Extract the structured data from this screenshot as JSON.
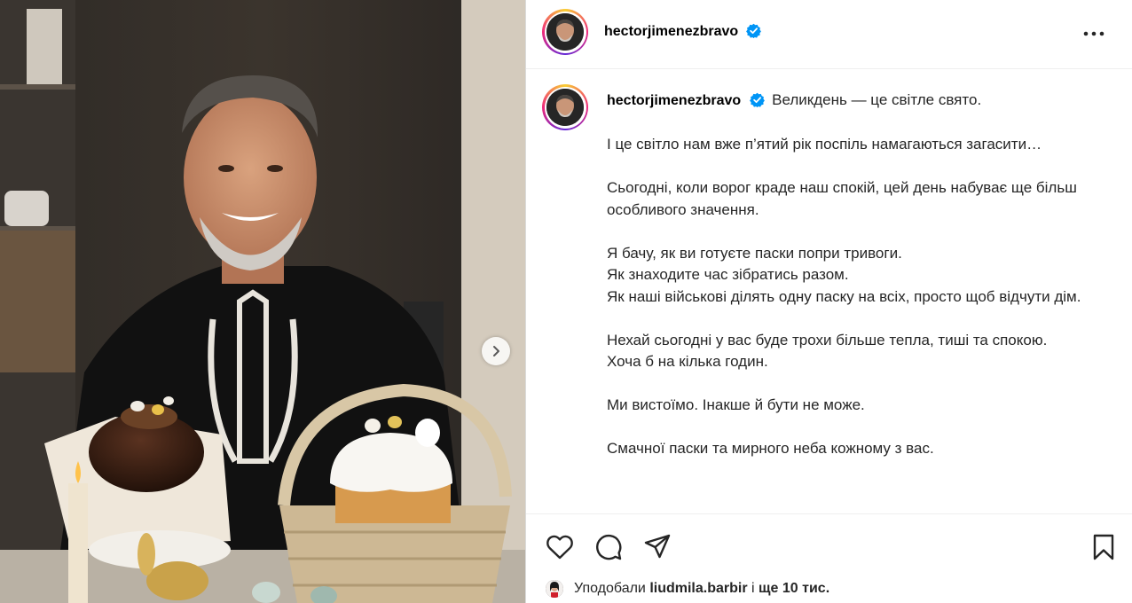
{
  "post": {
    "username": "hectorjimenezbravo",
    "verified": true
  },
  "caption": {
    "first_line": "Великдень — це світле свято.",
    "paragraphs": [
      "І це світло нам вже п’ятий рік поспіль намагаються загасити…",
      "Сьогодні, коли ворог краде наш спокій, цей день набуває ще більш особливого значення.",
      "Я бачу, як ви готуєте паски попри тривоги.\nЯк знаходите час зібратись разом.\nЯк наші військові ділять одну паску на всіх, просто щоб відчути дім.",
      "Нехай сьогодні у вас буде трохи більше тепла, тиші та спокою.\nХоча б на кілька годин.",
      "Ми вистоїмо. Інакше й бути не може.",
      "Смачної паски та мирного неба кожному з вас."
    ]
  },
  "likes": {
    "prefix": "Уподобали",
    "user": "liudmila.barbir",
    "connector": "і",
    "rest": "ще 10 тис."
  },
  "icons": {
    "next": "chevron-right-icon",
    "more": "more-horizontal-icon",
    "like": "heart-icon",
    "comment": "comment-icon",
    "share": "paper-plane-icon",
    "save": "bookmark-icon",
    "verified": "verified-badge-icon"
  },
  "colors": {
    "verified": "#0095f6",
    "text": "#262626",
    "border": "#dbdbdb"
  }
}
